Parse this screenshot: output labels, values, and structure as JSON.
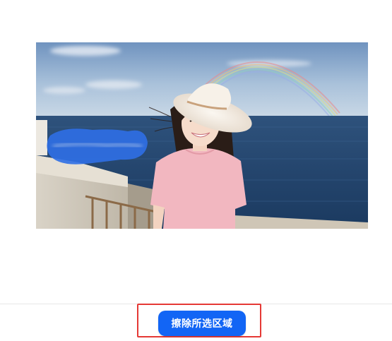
{
  "image": {
    "subject": "woman-in-pink-tshirt-and-sun-hat-by-sea",
    "selection_mask_color": "#2f6fe6"
  },
  "actions": {
    "erase_label": "擦除所选区域"
  },
  "colors": {
    "accent": "#1265f5",
    "highlight": "#e53935"
  }
}
